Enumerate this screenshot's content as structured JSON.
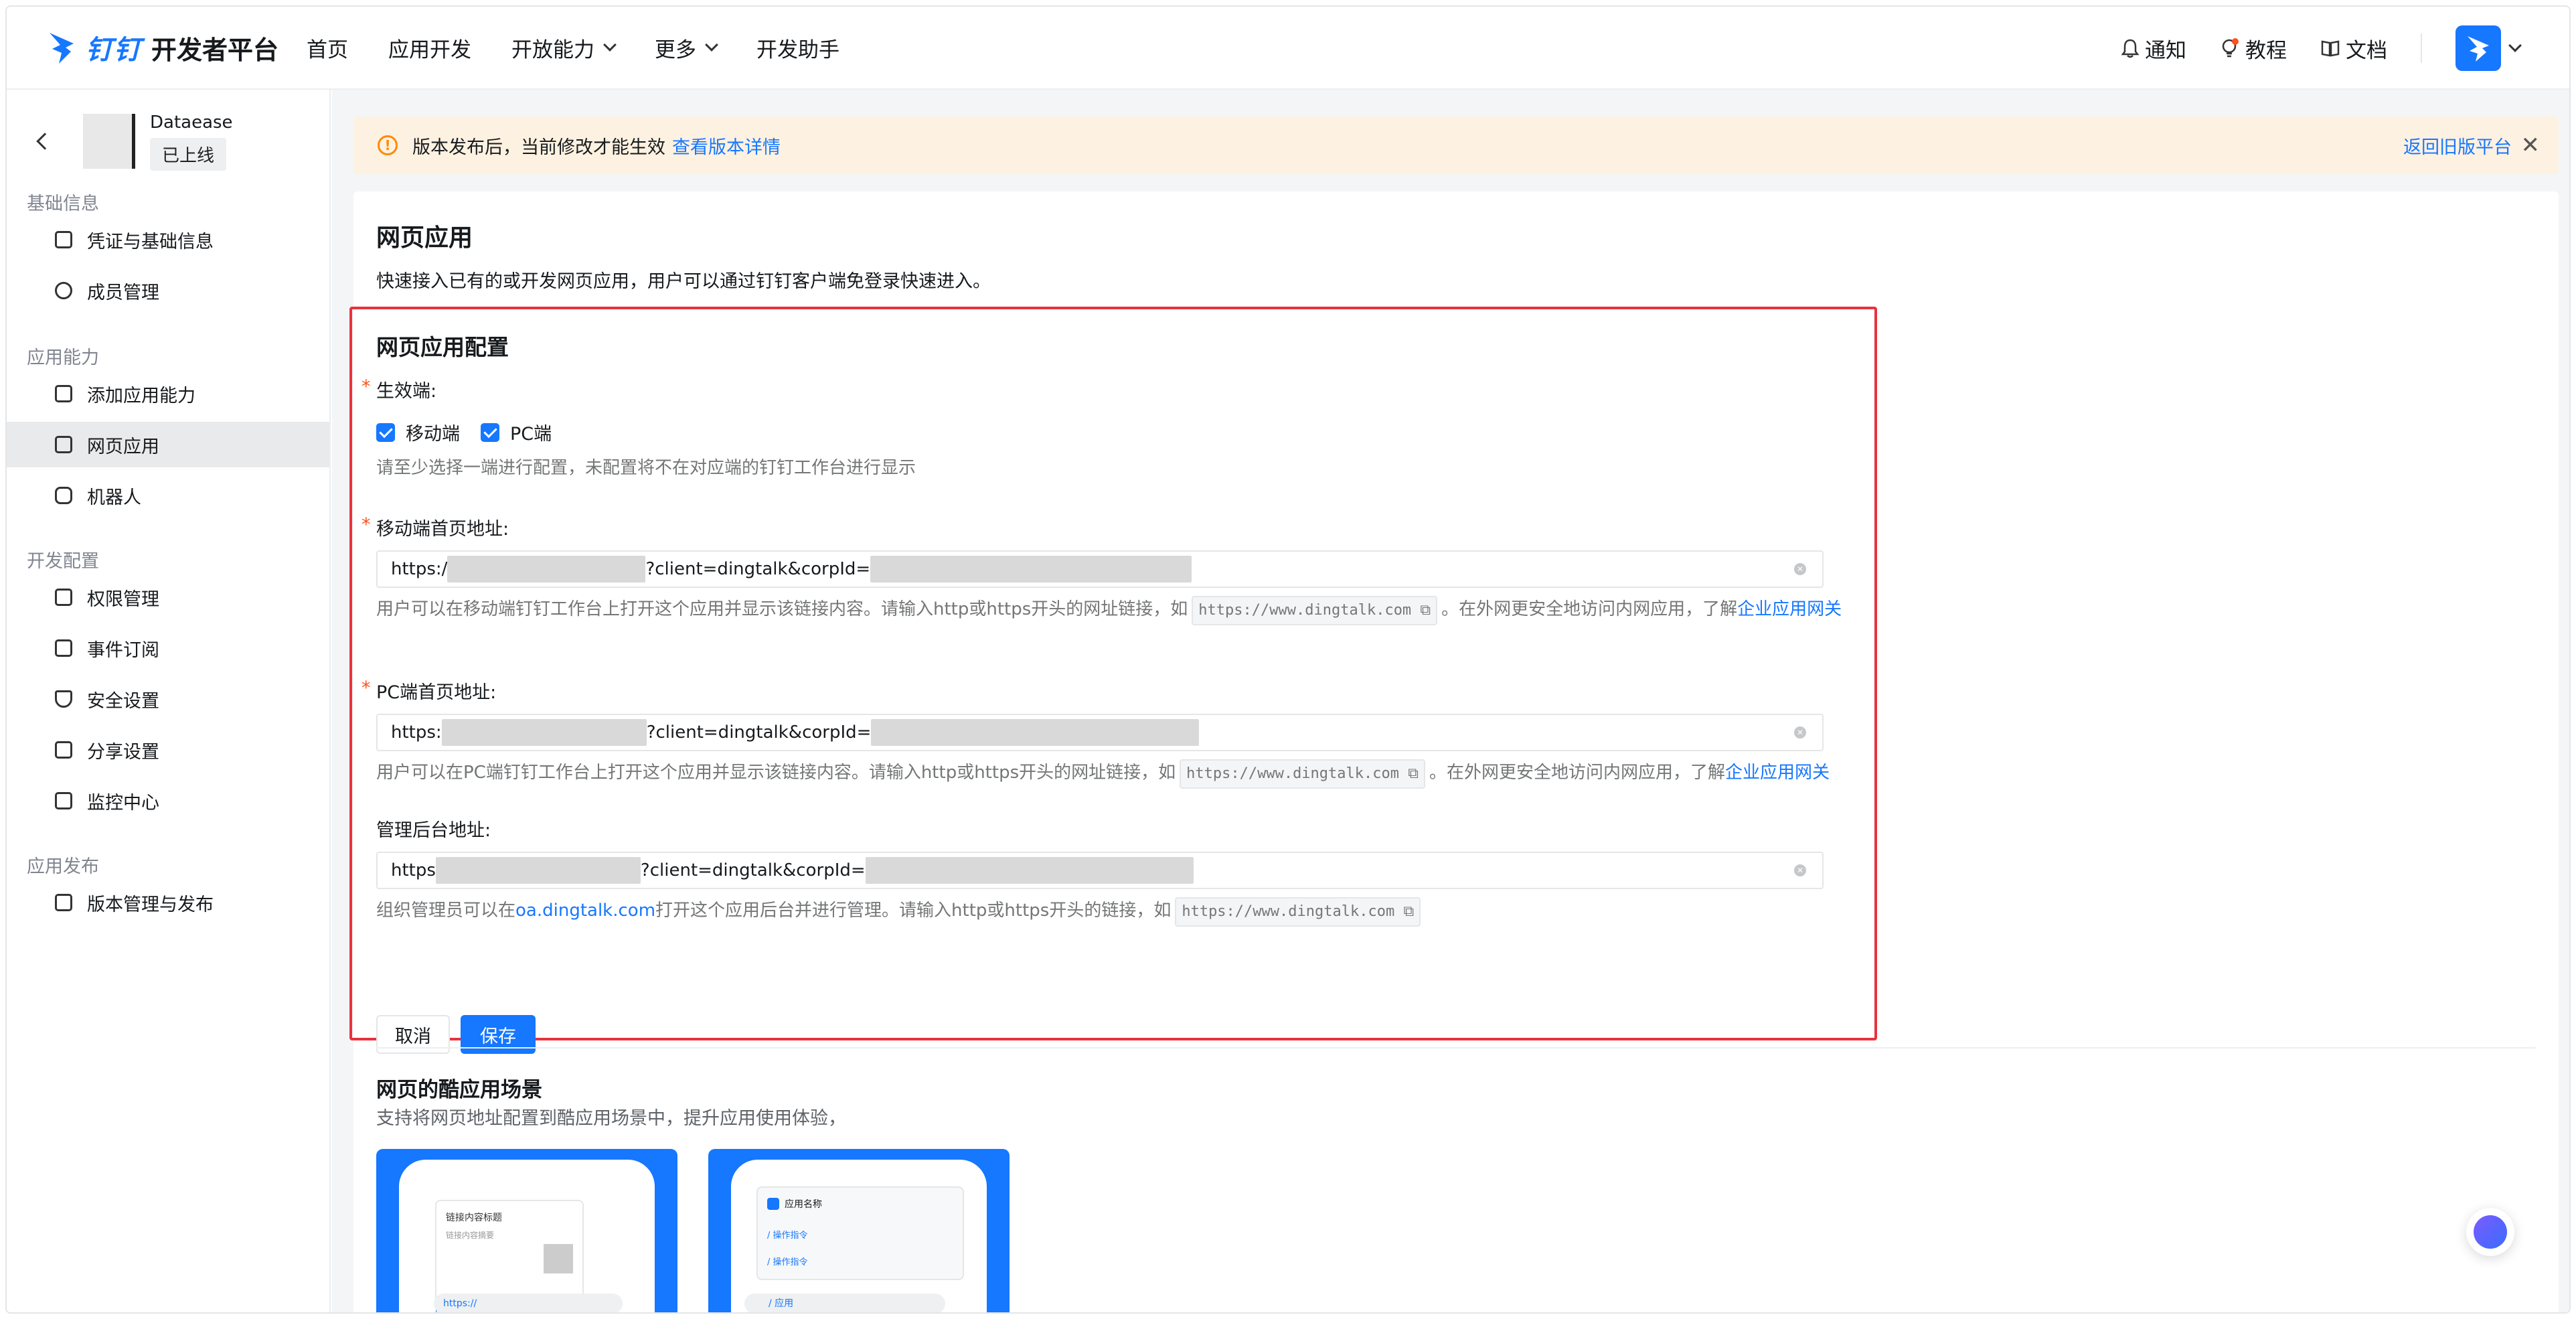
{
  "topbar": {
    "brand": "钉钉",
    "subtitle": "开发者平台",
    "nav": [
      "首页",
      "应用开发",
      "开放能力",
      "更多",
      "开发助手"
    ],
    "notify": "通知",
    "tutorial": "教程",
    "docs": "文档"
  },
  "sidebar": {
    "app_name": "Dataease",
    "app_status": "已上线",
    "groups": [
      {
        "title": "基础信息",
        "items": [
          "凭证与基础信息",
          "成员管理"
        ]
      },
      {
        "title": "应用能力",
        "items": [
          "添加应用能力",
          "网页应用",
          "机器人"
        ]
      },
      {
        "title": "开发配置",
        "items": [
          "权限管理",
          "事件订阅",
          "安全设置",
          "分享设置",
          "监控中心"
        ]
      },
      {
        "title": "应用发布",
        "items": [
          "版本管理与发布"
        ]
      }
    ]
  },
  "notice": {
    "text": "版本发布后，当前修改才能生效",
    "link": "查看版本详情",
    "return": "返回旧版平台"
  },
  "page": {
    "title": "网页应用",
    "desc": "快速接入已有的或开发网页应用，用户可以通过钉钉客户端免登录快速进入。",
    "config_title": "网页应用配置",
    "effective_label": "生效端:",
    "mobile": "移动端",
    "pc": "PC端",
    "effective_hint": "请至少选择一端进行配置，未配置将不在对应端的钉钉工作台进行显示",
    "mobile_label": "移动端首页地址:",
    "mobile_value_a": "https:/",
    "mobile_value_b": "?client=dingtalk&corpId=",
    "mobile_hint_a": "用户可以在移动端钉钉工作台上打开这个应用并显示该链接内容。请输入http或https开头的网址链接，如",
    "mobile_code": "https://www.dingtalk.com",
    "mobile_hint_b": "。在外网更安全地访问内网应用，了解",
    "mobile_hint_link": "企业应用网关",
    "pc_label": "PC端首页地址:",
    "pc_value_a": "https:",
    "pc_value_b": "?client=dingtalk&corpId=",
    "pc_hint_a": "用户可以在PC端钉钉工作台上打开这个应用并显示该链接内容。请输入http或https开头的网址链接，如",
    "pc_code": "https://www.dingtalk.com",
    "pc_hint_b": "。在外网更安全地访问内网应用，了解",
    "pc_hint_link": "企业应用网关",
    "admin_label": "管理后台地址:",
    "admin_value_a": "https",
    "admin_value_b": "?client=dingtalk&corpId=",
    "admin_hint_a": "组织管理员可以在",
    "admin_hint_link": "oa.dingtalk.com",
    "admin_hint_b": "打开这个应用后台并进行管理。请输入http或https开头的链接，如",
    "admin_code": "https://www.dingtalk.com",
    "cancel": "取消",
    "save": "保存",
    "scene_title": "网页的酷应用场景",
    "scene_desc": "支持将网页地址配置到酷应用场景中，提升应用使用体验，",
    "phone1_title": "链接内容标题",
    "phone1_sub": "链接内容摘要",
    "phone1_input": "https://",
    "phone2_title": "应用名称",
    "phone2_cmd": "操作指令",
    "phone2_input": "/ 应用"
  },
  "colors": {
    "accent": "#1677ff",
    "highlight": "#e8323c",
    "warn": "#ff8a00"
  }
}
